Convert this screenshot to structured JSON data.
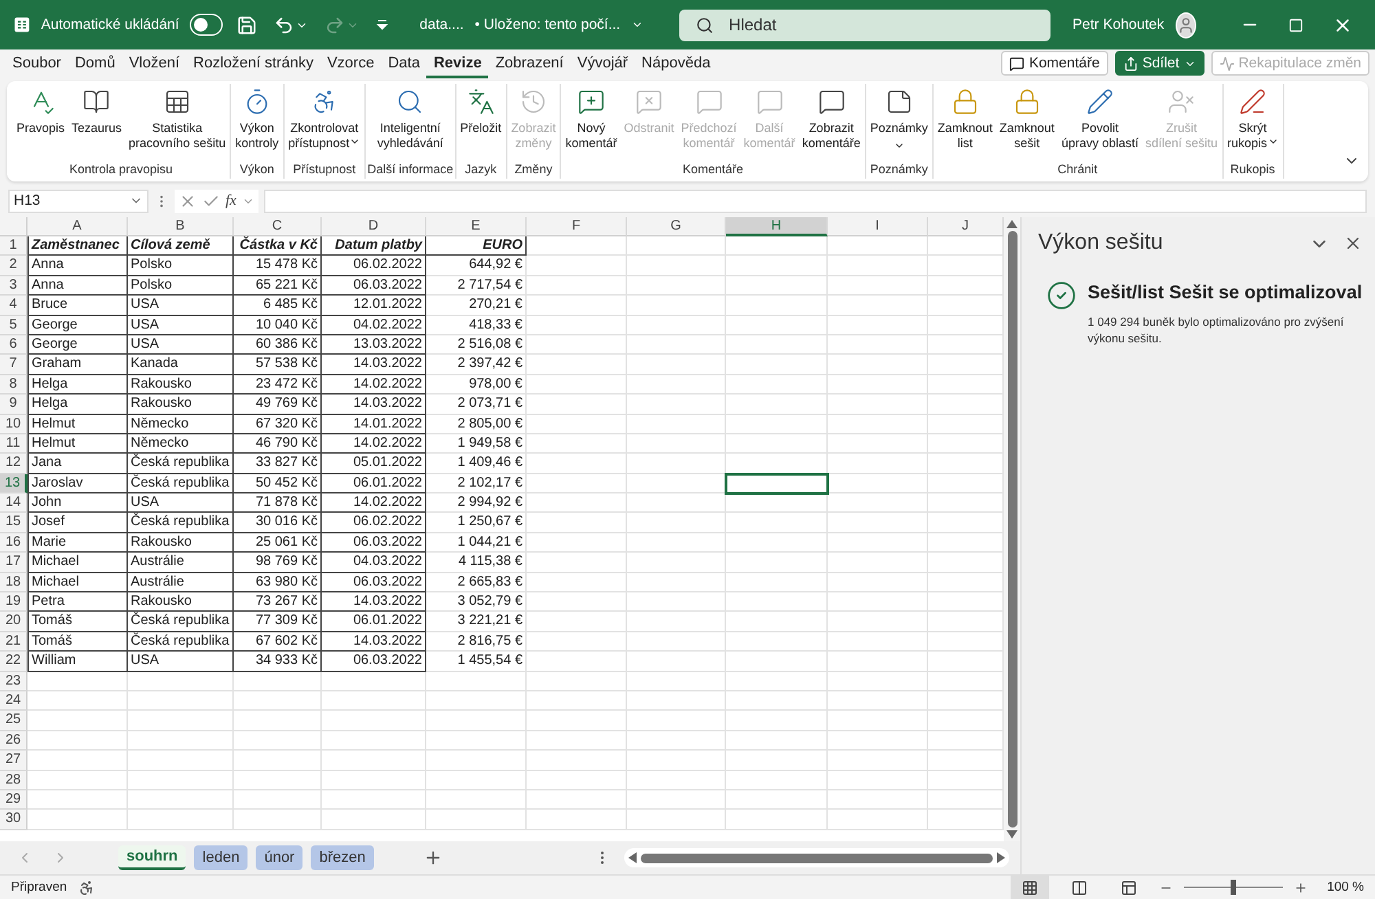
{
  "title_bar": {
    "autosave_label": "Automatické ukládání",
    "autosave_on": false,
    "quick_access": [
      {
        "kind": "save",
        "disabled": false,
        "dropdown": false
      },
      {
        "kind": "undo",
        "disabled": false,
        "dropdown": true
      },
      {
        "kind": "redo",
        "disabled": true,
        "dropdown": true
      },
      {
        "kind": "customize",
        "disabled": false,
        "dropdown": false
      }
    ],
    "file_name": "data....",
    "save_status": "• Uloženo: tento počí...",
    "search": {
      "placeholder": "Hledat"
    },
    "user": "Petr Kohoutek"
  },
  "ribbon_tabs": [
    {
      "label": "Soubor",
      "selected": false
    },
    {
      "label": "Domů",
      "selected": false
    },
    {
      "label": "Vložení",
      "selected": false
    },
    {
      "label": "Rozložení stránky",
      "selected": false
    },
    {
      "label": "Vzorce",
      "selected": false
    },
    {
      "label": "Data",
      "selected": false
    },
    {
      "label": "Revize",
      "selected": true
    },
    {
      "label": "Zobrazení",
      "selected": false
    },
    {
      "label": "Vývojář",
      "selected": false
    },
    {
      "label": "Nápověda",
      "selected": false
    }
  ],
  "ribbon_actions": [
    {
      "kind": "comments",
      "label": "Komentáře",
      "disabled": false
    },
    {
      "kind": "share",
      "label": "Sdílet",
      "disabled": false
    },
    {
      "kind": "changes",
      "label": "Rekapitulace změn",
      "disabled": true
    }
  ],
  "ribbon_groups": [
    {
      "label": "Kontrola pravopisu",
      "buttons": [
        {
          "kind": "spelling",
          "label": "Pravopis",
          "disabled": false,
          "dropdown": false
        },
        {
          "kind": "thesaurus",
          "label": "Tezaurus",
          "disabled": false,
          "dropdown": false
        },
        {
          "kind": "stats",
          "label": "Statistika\npracovního sešitu",
          "disabled": false,
          "dropdown": false
        }
      ]
    },
    {
      "label": "Výkon",
      "buttons": [
        {
          "kind": "performance",
          "label": "Výkon\nkontroly",
          "disabled": false,
          "dropdown": false
        }
      ]
    },
    {
      "label": "Přístupnost",
      "buttons": [
        {
          "kind": "accessibility",
          "label": "Zkontrolovat\npřístupnost",
          "disabled": false,
          "dropdown": true
        }
      ]
    },
    {
      "label": "Další informace",
      "buttons": [
        {
          "kind": "lookup",
          "label": "Inteligentní\nvyhledávání",
          "disabled": false,
          "dropdown": false
        }
      ]
    },
    {
      "label": "Jazyk",
      "buttons": [
        {
          "kind": "translate",
          "label": "Přeložit",
          "disabled": false,
          "dropdown": false
        }
      ]
    },
    {
      "label": "Změny",
      "buttons": [
        {
          "kind": "history",
          "label": "Zobrazit\nzměny",
          "disabled": true,
          "dropdown": false
        }
      ]
    },
    {
      "label": "Komentáře",
      "buttons": [
        {
          "kind": "newcomment",
          "label": "Nový\nkomentář",
          "disabled": false,
          "dropdown": false
        },
        {
          "kind": "deletecomment",
          "label": "Odstranit",
          "disabled": true,
          "dropdown": false
        },
        {
          "kind": "comment",
          "label": "Předchozí\nkomentář",
          "disabled": true,
          "dropdown": false
        },
        {
          "kind": "comment",
          "label": "Další\nkomentář",
          "disabled": true,
          "dropdown": false
        },
        {
          "kind": "comment",
          "label": "Zobrazit\nkomentáře",
          "disabled": false,
          "dropdown": false
        }
      ]
    },
    {
      "label": "Poznámky",
      "buttons": [
        {
          "kind": "note",
          "label": "Poznámky",
          "disabled": false,
          "dropdown": true
        }
      ]
    },
    {
      "label": "Chránit",
      "buttons": [
        {
          "kind": "lock",
          "label": "Zamknout\nlist",
          "disabled": false,
          "dropdown": false
        },
        {
          "kind": "lock",
          "label": "Zamknout\nsešit",
          "disabled": false,
          "dropdown": false
        },
        {
          "kind": "edit",
          "label": "Povolit\núpravy oblastí",
          "disabled": false,
          "dropdown": false
        },
        {
          "kind": "unshare",
          "label": "Zrušit\nsdílení sešitu",
          "disabled": true,
          "dropdown": false
        }
      ]
    },
    {
      "label": "Rukopis",
      "buttons": [
        {
          "kind": "ink",
          "label": "Skrýt\nrukopis",
          "disabled": false,
          "dropdown": true
        }
      ]
    }
  ],
  "formula_bar": {
    "name_box": "H13",
    "function_label": "fx"
  },
  "sheet": {
    "columns": [
      {
        "label": "A",
        "selected": false
      },
      {
        "label": "B",
        "selected": false
      },
      {
        "label": "C",
        "selected": false
      },
      {
        "label": "D",
        "selected": false
      },
      {
        "label": "E",
        "selected": false
      },
      {
        "label": "F",
        "selected": false
      },
      {
        "label": "G",
        "selected": false
      },
      {
        "label": "H",
        "selected": true
      },
      {
        "label": "I",
        "selected": false
      },
      {
        "label": "J",
        "selected": false
      }
    ],
    "rows": [
      {
        "number": "1",
        "kind": "header",
        "selected": false,
        "cells": [
          "Zaměstnanec",
          "Cílová země",
          "Částka v Kč",
          "Datum platby",
          "EURO"
        ]
      },
      {
        "number": "2",
        "kind": "data",
        "selected": false,
        "cells": [
          "Anna",
          "Polsko",
          "15 478 Kč",
          "06.02.2022",
          "644,92 €"
        ]
      },
      {
        "number": "3",
        "kind": "data",
        "selected": false,
        "cells": [
          "Anna",
          "Polsko",
          "65 221 Kč",
          "06.03.2022",
          "2 717,54 €"
        ]
      },
      {
        "number": "4",
        "kind": "data",
        "selected": false,
        "cells": [
          "Bruce",
          "USA",
          "6 485 Kč",
          "12.01.2022",
          "270,21 €"
        ]
      },
      {
        "number": "5",
        "kind": "data",
        "selected": false,
        "cells": [
          "George",
          "USA",
          "10 040 Kč",
          "04.02.2022",
          "418,33 €"
        ]
      },
      {
        "number": "6",
        "kind": "data",
        "selected": false,
        "cells": [
          "George",
          "USA",
          "60 386 Kč",
          "13.03.2022",
          "2 516,08 €"
        ]
      },
      {
        "number": "7",
        "kind": "data",
        "selected": false,
        "cells": [
          "Graham",
          "Kanada",
          "57 538 Kč",
          "14.03.2022",
          "2 397,42 €"
        ]
      },
      {
        "number": "8",
        "kind": "data",
        "selected": false,
        "cells": [
          "Helga",
          "Rakousko",
          "23 472 Kč",
          "14.02.2022",
          "978,00 €"
        ]
      },
      {
        "number": "9",
        "kind": "data",
        "selected": false,
        "cells": [
          "Helga",
          "Rakousko",
          "49 769 Kč",
          "14.03.2022",
          "2 073,71 €"
        ]
      },
      {
        "number": "10",
        "kind": "data",
        "selected": false,
        "cells": [
          "Helmut",
          "Německo",
          "67 320 Kč",
          "14.01.2022",
          "2 805,00 €"
        ]
      },
      {
        "number": "11",
        "kind": "data",
        "selected": false,
        "cells": [
          "Helmut",
          "Německo",
          "46 790 Kč",
          "14.02.2022",
          "1 949,58 €"
        ]
      },
      {
        "number": "12",
        "kind": "data",
        "selected": false,
        "cells": [
          "Jana",
          "Česká republika",
          "33 827 Kč",
          "05.01.2022",
          "1 409,46 €"
        ]
      },
      {
        "number": "13",
        "kind": "data",
        "selected": true,
        "cells": [
          "Jaroslav",
          "Česká republika",
          "50 452 Kč",
          "06.01.2022",
          "2 102,17 €"
        ]
      },
      {
        "number": "14",
        "kind": "data",
        "selected": false,
        "cells": [
          "John",
          "USA",
          "71 878 Kč",
          "14.02.2022",
          "2 994,92 €"
        ]
      },
      {
        "number": "15",
        "kind": "data",
        "selected": false,
        "cells": [
          "Josef",
          "Česká republika",
          "30 016 Kč",
          "06.02.2022",
          "1 250,67 €"
        ]
      },
      {
        "number": "16",
        "kind": "data",
        "selected": false,
        "cells": [
          "Marie",
          "Rakousko",
          "25 061 Kč",
          "06.03.2022",
          "1 044,21 €"
        ]
      },
      {
        "number": "17",
        "kind": "data",
        "selected": false,
        "cells": [
          "Michael",
          "Austrálie",
          "98 769 Kč",
          "04.03.2022",
          "4 115,38 €"
        ]
      },
      {
        "number": "18",
        "kind": "data",
        "selected": false,
        "cells": [
          "Michael",
          "Austrálie",
          "63 980 Kč",
          "06.03.2022",
          "2 665,83 €"
        ]
      },
      {
        "number": "19",
        "kind": "data",
        "selected": false,
        "cells": [
          "Petra",
          "Rakousko",
          "73 267 Kč",
          "14.03.2022",
          "3 052,79 €"
        ]
      },
      {
        "number": "20",
        "kind": "data",
        "selected": false,
        "cells": [
          "Tomáš",
          "Česká republika",
          "77 309 Kč",
          "06.01.2022",
          "3 221,21 €"
        ]
      },
      {
        "number": "21",
        "kind": "data",
        "selected": false,
        "cells": [
          "Tomáš",
          "Česká republika",
          "67 602 Kč",
          "14.03.2022",
          "2 816,75 €"
        ]
      },
      {
        "number": "22",
        "kind": "data",
        "selected": false,
        "cells": [
          "William",
          "USA",
          "34 933 Kč",
          "06.03.2022",
          "1 455,54 €"
        ]
      },
      {
        "number": "23",
        "kind": "empty",
        "selected": false
      },
      {
        "number": "24",
        "kind": "empty",
        "selected": false
      },
      {
        "number": "25",
        "kind": "empty",
        "selected": false
      },
      {
        "number": "26",
        "kind": "empty",
        "selected": false
      },
      {
        "number": "27",
        "kind": "empty",
        "selected": false
      },
      {
        "number": "28",
        "kind": "empty",
        "selected": false
      },
      {
        "number": "29",
        "kind": "empty",
        "selected": false
      },
      {
        "number": "30",
        "kind": "empty",
        "selected": false
      }
    ]
  },
  "sheet_tabs": [
    {
      "label": "souhrn",
      "selected": true
    },
    {
      "label": "leden",
      "selected": false,
      "color": "#b4c6e7"
    },
    {
      "label": "únor",
      "selected": false,
      "color": "#b4c6e7"
    },
    {
      "label": "březen",
      "selected": false,
      "color": "#b4c6e7"
    }
  ],
  "side_pane": {
    "title": "Výkon sešitu",
    "message_title": "Sešit/list Sešit se optimalizoval",
    "message": "1 049 294 buněk bylo optimalizováno pro zvýšení výkonu sešitu."
  },
  "status_bar": {
    "status": "Připraven",
    "views": [
      {
        "kind": "normal",
        "selected": true
      },
      {
        "kind": "layout",
        "selected": false
      },
      {
        "kind": "pagebreak",
        "selected": false
      }
    ],
    "zoom": {
      "level": 0.5,
      "label": "100 %"
    }
  }
}
